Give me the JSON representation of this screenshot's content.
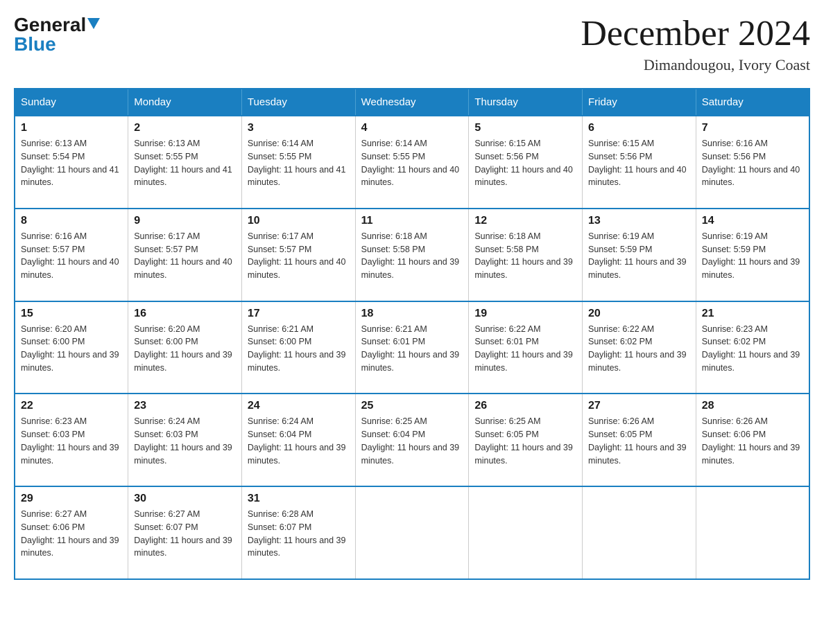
{
  "logo": {
    "general": "General",
    "blue": "Blue"
  },
  "title": "December 2024",
  "subtitle": "Dimandougou, Ivory Coast",
  "weekdays": [
    "Sunday",
    "Monday",
    "Tuesday",
    "Wednesday",
    "Thursday",
    "Friday",
    "Saturday"
  ],
  "weeks": [
    [
      {
        "day": "1",
        "sunrise": "6:13 AM",
        "sunset": "5:54 PM",
        "daylight": "11 hours and 41 minutes."
      },
      {
        "day": "2",
        "sunrise": "6:13 AM",
        "sunset": "5:55 PM",
        "daylight": "11 hours and 41 minutes."
      },
      {
        "day": "3",
        "sunrise": "6:14 AM",
        "sunset": "5:55 PM",
        "daylight": "11 hours and 41 minutes."
      },
      {
        "day": "4",
        "sunrise": "6:14 AM",
        "sunset": "5:55 PM",
        "daylight": "11 hours and 40 minutes."
      },
      {
        "day": "5",
        "sunrise": "6:15 AM",
        "sunset": "5:56 PM",
        "daylight": "11 hours and 40 minutes."
      },
      {
        "day": "6",
        "sunrise": "6:15 AM",
        "sunset": "5:56 PM",
        "daylight": "11 hours and 40 minutes."
      },
      {
        "day": "7",
        "sunrise": "6:16 AM",
        "sunset": "5:56 PM",
        "daylight": "11 hours and 40 minutes."
      }
    ],
    [
      {
        "day": "8",
        "sunrise": "6:16 AM",
        "sunset": "5:57 PM",
        "daylight": "11 hours and 40 minutes."
      },
      {
        "day": "9",
        "sunrise": "6:17 AM",
        "sunset": "5:57 PM",
        "daylight": "11 hours and 40 minutes."
      },
      {
        "day": "10",
        "sunrise": "6:17 AM",
        "sunset": "5:57 PM",
        "daylight": "11 hours and 40 minutes."
      },
      {
        "day": "11",
        "sunrise": "6:18 AM",
        "sunset": "5:58 PM",
        "daylight": "11 hours and 39 minutes."
      },
      {
        "day": "12",
        "sunrise": "6:18 AM",
        "sunset": "5:58 PM",
        "daylight": "11 hours and 39 minutes."
      },
      {
        "day": "13",
        "sunrise": "6:19 AM",
        "sunset": "5:59 PM",
        "daylight": "11 hours and 39 minutes."
      },
      {
        "day": "14",
        "sunrise": "6:19 AM",
        "sunset": "5:59 PM",
        "daylight": "11 hours and 39 minutes."
      }
    ],
    [
      {
        "day": "15",
        "sunrise": "6:20 AM",
        "sunset": "6:00 PM",
        "daylight": "11 hours and 39 minutes."
      },
      {
        "day": "16",
        "sunrise": "6:20 AM",
        "sunset": "6:00 PM",
        "daylight": "11 hours and 39 minutes."
      },
      {
        "day": "17",
        "sunrise": "6:21 AM",
        "sunset": "6:00 PM",
        "daylight": "11 hours and 39 minutes."
      },
      {
        "day": "18",
        "sunrise": "6:21 AM",
        "sunset": "6:01 PM",
        "daylight": "11 hours and 39 minutes."
      },
      {
        "day": "19",
        "sunrise": "6:22 AM",
        "sunset": "6:01 PM",
        "daylight": "11 hours and 39 minutes."
      },
      {
        "day": "20",
        "sunrise": "6:22 AM",
        "sunset": "6:02 PM",
        "daylight": "11 hours and 39 minutes."
      },
      {
        "day": "21",
        "sunrise": "6:23 AM",
        "sunset": "6:02 PM",
        "daylight": "11 hours and 39 minutes."
      }
    ],
    [
      {
        "day": "22",
        "sunrise": "6:23 AM",
        "sunset": "6:03 PM",
        "daylight": "11 hours and 39 minutes."
      },
      {
        "day": "23",
        "sunrise": "6:24 AM",
        "sunset": "6:03 PM",
        "daylight": "11 hours and 39 minutes."
      },
      {
        "day": "24",
        "sunrise": "6:24 AM",
        "sunset": "6:04 PM",
        "daylight": "11 hours and 39 minutes."
      },
      {
        "day": "25",
        "sunrise": "6:25 AM",
        "sunset": "6:04 PM",
        "daylight": "11 hours and 39 minutes."
      },
      {
        "day": "26",
        "sunrise": "6:25 AM",
        "sunset": "6:05 PM",
        "daylight": "11 hours and 39 minutes."
      },
      {
        "day": "27",
        "sunrise": "6:26 AM",
        "sunset": "6:05 PM",
        "daylight": "11 hours and 39 minutes."
      },
      {
        "day": "28",
        "sunrise": "6:26 AM",
        "sunset": "6:06 PM",
        "daylight": "11 hours and 39 minutes."
      }
    ],
    [
      {
        "day": "29",
        "sunrise": "6:27 AM",
        "sunset": "6:06 PM",
        "daylight": "11 hours and 39 minutes."
      },
      {
        "day": "30",
        "sunrise": "6:27 AM",
        "sunset": "6:07 PM",
        "daylight": "11 hours and 39 minutes."
      },
      {
        "day": "31",
        "sunrise": "6:28 AM",
        "sunset": "6:07 PM",
        "daylight": "11 hours and 39 minutes."
      },
      null,
      null,
      null,
      null
    ]
  ]
}
